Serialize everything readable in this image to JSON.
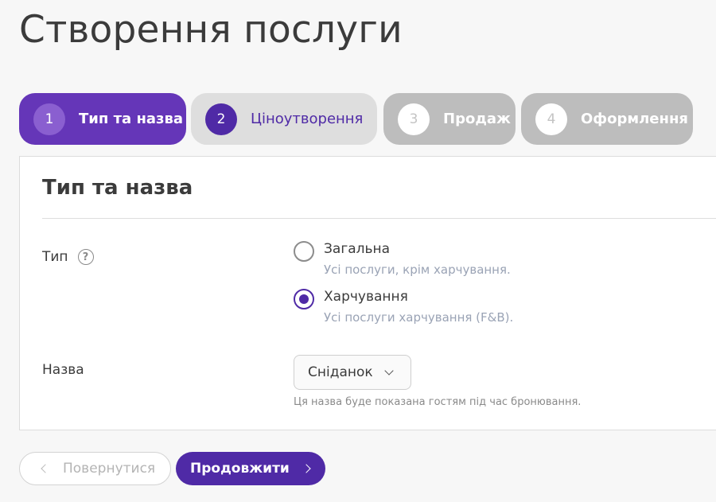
{
  "page": {
    "title": "Створення послуги"
  },
  "stepper": {
    "steps": [
      {
        "number": "1",
        "label": "Тип та назва",
        "state": "active"
      },
      {
        "number": "2",
        "label": "Ціноутворення",
        "state": "next"
      },
      {
        "number": "3",
        "label": "Продаж",
        "state": "disabled"
      },
      {
        "number": "4",
        "label": "Оформлення",
        "state": "disabled"
      }
    ]
  },
  "card": {
    "title": "Тип та назва",
    "type_field": {
      "label": "Тип",
      "help_icon": "question-circle-icon",
      "options": [
        {
          "title": "Загальна",
          "description": "Усі послуги, крім харчування.",
          "checked": false
        },
        {
          "title": "Харчування",
          "description": "Усі послуги харчування (F&B).",
          "checked": true
        }
      ]
    },
    "name_field": {
      "label": "Назва",
      "value": "Сніданок",
      "hint": "Ця назва буде показана гостям під час бронювання."
    }
  },
  "footer": {
    "back_label": "Повернутися",
    "next_label": "Продовжити"
  },
  "colors": {
    "accent": "#4f2aa6",
    "active_step": "#6536b8",
    "disabled_step": "#bdbdbd"
  }
}
